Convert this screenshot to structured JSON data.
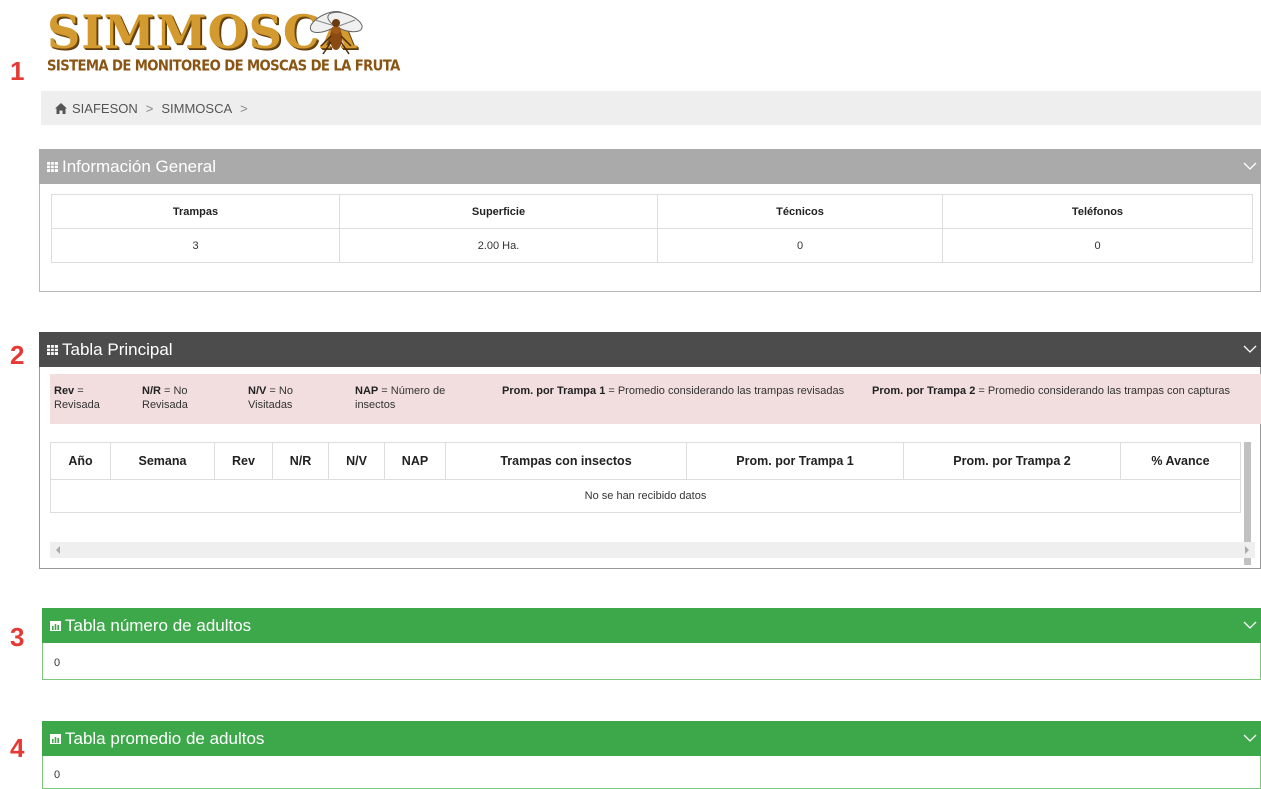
{
  "logo": {
    "title": "SIMMOSCA",
    "subtitle": "SISTEMA DE MONITOREO DE MOSCAS DE LA FRUTA",
    "icon": "fruit-fly-icon"
  },
  "markers": [
    "1",
    "2",
    "3",
    "4"
  ],
  "breadcrumb": {
    "icon": "home-icon",
    "items": [
      "SIAFESON",
      "SIMMOSCA"
    ],
    "separator": ">"
  },
  "info_panel": {
    "title": "Información General",
    "headers": [
      "Trampas",
      "Superficie",
      "Técnicos",
      "Teléfonos"
    ],
    "values": [
      "3",
      "2.00 Ha.",
      "0",
      "0"
    ]
  },
  "main_panel": {
    "title": "Tabla Principal",
    "legend": [
      {
        "key": "Rev",
        "text": " = Revisada"
      },
      {
        "key": "N/R",
        "text": " = No Revisada"
      },
      {
        "key": "N/V",
        "text": " = No Visitadas"
      },
      {
        "key": "NAP",
        "text": " = Número de insectos"
      },
      {
        "key": "Prom. por Trampa 1",
        "text": " = Promedio considerando las trampas revisadas"
      },
      {
        "key": "Prom. por Trampa 2",
        "text": " = Promedio considerando las trampas con capturas"
      }
    ],
    "headers": [
      "Año",
      "Semana",
      "Rev",
      "N/R",
      "N/V",
      "NAP",
      "Trampas con insectos",
      "Prom. por Trampa 1",
      "Prom. por Trampa 2",
      "% Avance"
    ],
    "empty_message": "No se han recibido datos"
  },
  "adults_panel": {
    "title": "Tabla número de adultos",
    "value": "0"
  },
  "avg_panel": {
    "title": "Tabla promedio de adultos",
    "value": "0"
  },
  "colors": {
    "info_header": "#aaaaaa",
    "main_header": "#4c4c4c",
    "green_header": "#3da84a",
    "legend_bg": "#f2dede",
    "marker": "#e53935",
    "logo_gold": "#d29a2f"
  }
}
